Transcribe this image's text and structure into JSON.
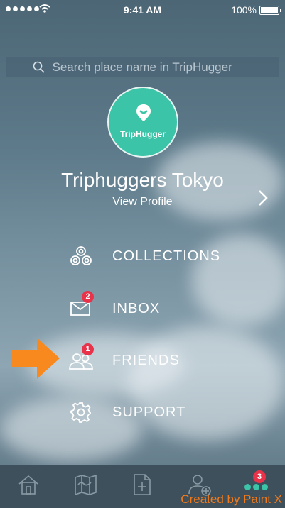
{
  "status": {
    "time": "9:41 AM",
    "battery_pct": "100%"
  },
  "search": {
    "placeholder": "Search place name in TripHugger"
  },
  "profile": {
    "logo_text": "TripHugger",
    "name": "Triphuggers Tokyo",
    "view_profile": "View Profile"
  },
  "menu": {
    "items": [
      {
        "label": "COLLECTIONS",
        "icon": "spiral-icon",
        "badge": ""
      },
      {
        "label": "INBOX",
        "icon": "envelope-icon",
        "badge": "2"
      },
      {
        "label": "FRIENDS",
        "icon": "people-icon",
        "badge": "1"
      },
      {
        "label": "SUPPORT",
        "icon": "gear-icon",
        "badge": ""
      }
    ]
  },
  "tabbar": {
    "tabs": [
      {
        "icon": "home-icon"
      },
      {
        "icon": "map-icon"
      },
      {
        "icon": "add-document-icon"
      },
      {
        "icon": "add-person-icon"
      },
      {
        "icon": "more-dots-icon",
        "badge": "3"
      }
    ]
  },
  "credit": "Created by Paint X",
  "colors": {
    "accent": "#3bc4a7",
    "badge": "#e8334a",
    "tabbar": "#3d505b",
    "pointer": "#f7891f"
  }
}
